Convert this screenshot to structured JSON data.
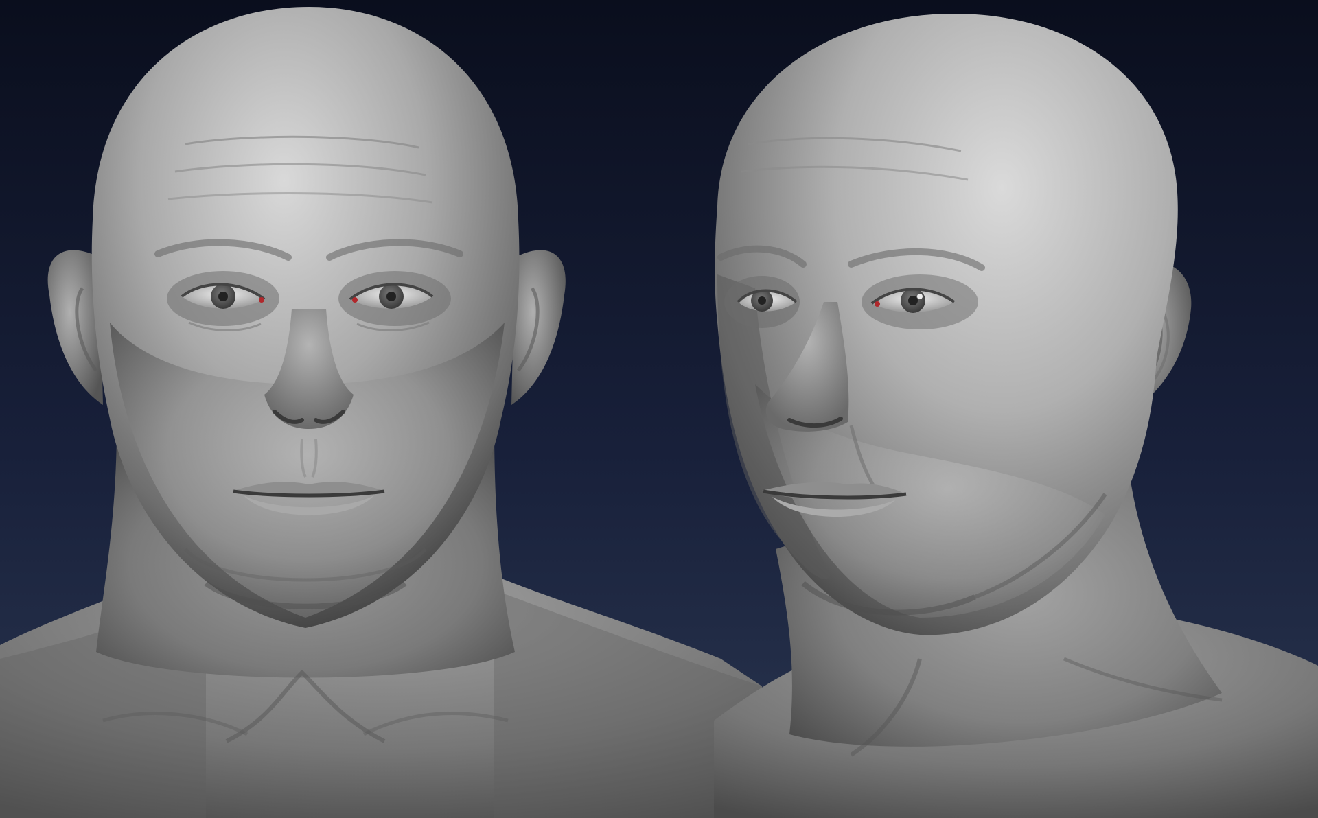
{
  "scene": {
    "background": {
      "top": "#0a0e1d",
      "bottom": "#2a3650"
    },
    "clay": {
      "light": "#d4d4d4",
      "mid": "#9c9c9c",
      "dark": "#3f3f3f"
    },
    "iris": "#5a5a5a",
    "caruncle": "#b0282c"
  },
  "views": [
    {
      "name": "front-view",
      "description_icon": "sculpted-head-front-icon"
    },
    {
      "name": "three-quarter-view",
      "description_icon": "sculpted-head-three-quarter-icon"
    }
  ]
}
